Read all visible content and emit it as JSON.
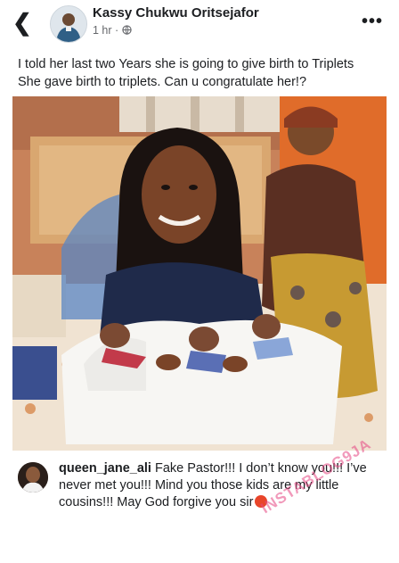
{
  "post": {
    "author_name": "Kassy Chukwu Oritsejafor",
    "time_ago": "1 hr ·",
    "caption_line1": "I told her last two Years she is going to give birth to Triplets",
    "caption_line2": "She gave birth to triplets. Can u congratulate her!?"
  },
  "icons": {
    "back": "chevron-left-icon",
    "privacy": "globe-icon",
    "more": "more-dots-icon"
  },
  "glyphs": {
    "back": "❮",
    "more": "•••"
  },
  "comment": {
    "username": "queen_jane_ali",
    "text": "Fake Pastor!!! I don’t know you!!! I’ve never met you!!! Mind you those kids are my little cousins!!! May God forgive you sir"
  },
  "watermark": {
    "text": "INSTABLOG9JA"
  },
  "colors": {
    "text_primary": "#1c1e21",
    "text_secondary": "#65676b",
    "watermark": "#e64682"
  }
}
